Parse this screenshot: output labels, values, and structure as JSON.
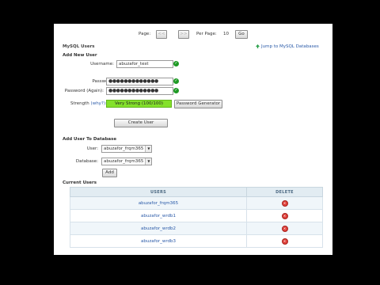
{
  "pagination": {
    "page_label": "Page:",
    "first_btn": "<<",
    "last_btn": ">>",
    "per_page_label": "Per Page:",
    "per_page_value": "10",
    "go_label": "Go"
  },
  "section_title": "MySQL Users",
  "jump_link": "Jump to MySQL Databases",
  "add_user": {
    "heading": "Add New User",
    "username_label": "Username:",
    "username_value": "abuzafor_test",
    "password_label": "Password:",
    "password_value": "●●●●●●●●●●●●●",
    "password_again_label": "Password (Again):",
    "password_again_value": "●●●●●●●●●●●●●",
    "strength_label": "Strength",
    "why_link": "(why?):",
    "strength_value": "Very Strong (100/100)",
    "strength_color": "#84e12b",
    "generator_button": "Password Generator",
    "create_button": "Create User"
  },
  "add_to_db": {
    "heading": "Add User To Database",
    "user_label": "User:",
    "user_value": "abuzafor_frqm365",
    "database_label": "Database:",
    "database_value": "abuzafor_frqm365",
    "add_button": "Add"
  },
  "current_users": {
    "heading": "Current Users",
    "col_users": "Users",
    "col_delete": "Delete",
    "rows": [
      {
        "user": "abuzafor_frqm365"
      },
      {
        "user": "abuzafor_wrdb1"
      },
      {
        "user": "abuzafor_wrdb2"
      },
      {
        "user": "abuzafor_wrdb3"
      }
    ]
  }
}
